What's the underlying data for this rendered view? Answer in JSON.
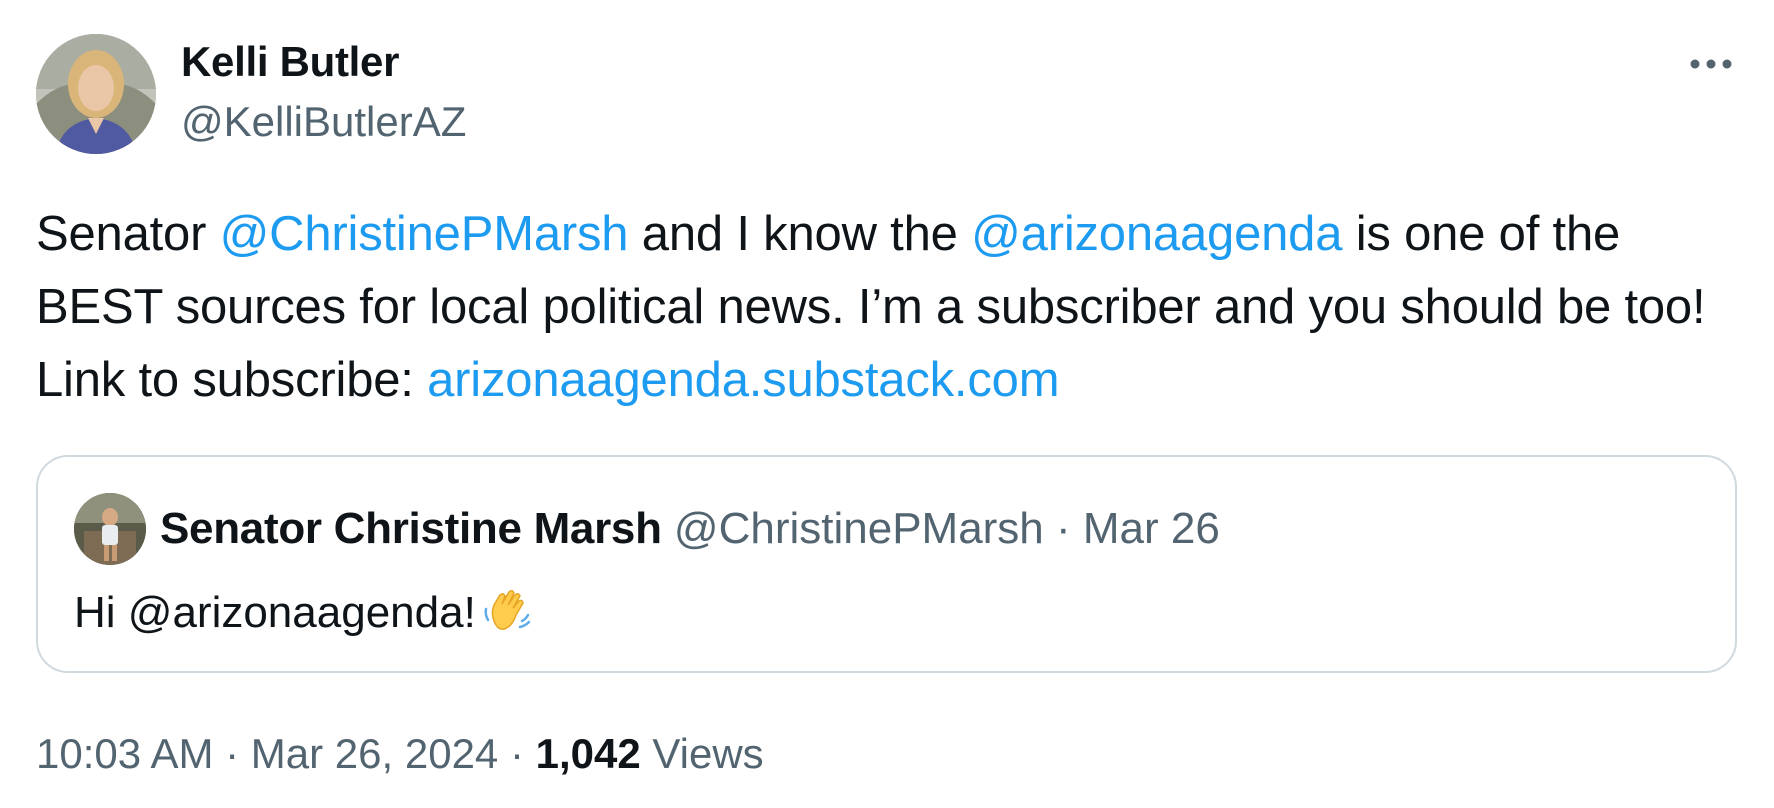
{
  "author": {
    "name": "Kelli Butler",
    "handle": "@KelliButlerAZ"
  },
  "tweet": {
    "text_1": "Senator ",
    "mention_1": "@ChristinePMarsh",
    "text_2": " and I know the ",
    "mention_2": "@arizonaagenda",
    "text_3": " is one of the BEST sources for local political news. I’m a subscriber and you should be too! Link to subscribe: ",
    "link": "arizonaagenda.substack.com"
  },
  "quoted": {
    "name": "Senator Christine Marsh",
    "handle": "@ChristinePMarsh",
    "separator": " · ",
    "date": "Mar 26",
    "text": "Hi @arizonaagenda!",
    "emoji": "waving-hand-icon"
  },
  "footer": {
    "time": "10:03 AM",
    "separator_1": " · ",
    "date": "Mar 26, 2024",
    "separator_2": " · ",
    "views_count": "1,042",
    "views_label": " Views"
  },
  "colors": {
    "link": "#1d9bf0",
    "secondary_text": "#536471",
    "primary_text": "#0f1419",
    "border": "#cfd9de"
  }
}
